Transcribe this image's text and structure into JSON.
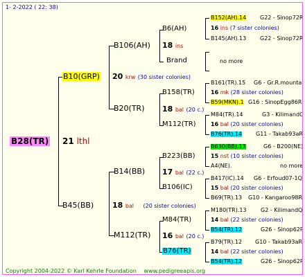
{
  "header": {
    "date": "1-  2-2022 ( 22: 38)"
  },
  "footer": {
    "copyright": "Copyright 2004-2022 © Karl Kehrle Foundation",
    "website": "www.pedigreeapis.org"
  },
  "root": {
    "code": "B28(TR)",
    "num": "21",
    "tag": "lthl"
  },
  "g1_father": {
    "code": "B10(GRP)",
    "num": "20",
    "tag": "krw",
    "sisters": "(30 sister colonies)"
  },
  "g1_mother": {
    "code": "B45(BB)",
    "num": "18",
    "tag": "bal",
    "sisters": "(20 sister colonies)"
  },
  "g2": {
    "b106": {
      "code": "B106(AH)",
      "num": "18",
      "tag": "ins"
    },
    "b20": {
      "code": "B20(TR)"
    },
    "b14": {
      "code": "B14(BB)",
      "num": "17",
      "tag": "bal",
      "sisters": "(22 c.)"
    },
    "m112": {
      "code": "M112(TR)",
      "num": "16",
      "tag": "bal",
      "sisters": "(20 c.)"
    }
  },
  "g3": {
    "b6": {
      "code": "B6(AH)"
    },
    "brand": {
      "code": "Brand"
    },
    "b158": {
      "code": "B158(TR)",
      "num": "18",
      "tag": "bal",
      "sisters": "(20 c.)"
    },
    "m112b": {
      "code": "M112(TR)"
    },
    "b223": {
      "code": "B223(BB)",
      "num": "17",
      "tag": "bal",
      "sisters": "(22 c.)"
    },
    "b106ic": {
      "code": "B106(IC)"
    },
    "m84": {
      "code": "M84(TR)",
      "num": "16",
      "tag": "bal",
      "sisters": "(20 c.)"
    },
    "b76": {
      "code": "B76(TR)"
    }
  },
  "g4": [
    {
      "code": "B152(AH).14",
      "ref": "G22 - Sinop72R"
    },
    {
      "num": "16",
      "tag": "ins",
      "sisters": "(7 sister colonies)"
    },
    {
      "code": "B145(AH).13",
      "ref": "G22 - Sinop72R"
    },
    {
      "text": "no more"
    },
    {
      "code": "B161(TR).15",
      "ref": "G6 - Gr.R.mounta"
    },
    {
      "num": "16",
      "tag": "mk",
      "sisters": "(28 sister colonies)"
    },
    {
      "code": "B59(MKN).1",
      "ref": "G16 : SinopEgg86R"
    },
    {
      "code": "M84(TR).14",
      "ref": "G3 - KilimandQ"
    },
    {
      "num": "16",
      "tag": "bal",
      "sisters": "(20 sister colonies)"
    },
    {
      "code": "B76(TR).14",
      "ref": "G11 - Takab93aR"
    },
    {
      "code": "B630(BB).13",
      "ref": "G6 - B200(NE)"
    },
    {
      "num": "15",
      "tag": "nst",
      "sisters": "(10 sister colonies)"
    },
    {
      "code": "A4(NE).",
      "ref": "no more"
    },
    {
      "code": "B417(IC).14",
      "ref": "G6 - Erfoud07-1Q"
    },
    {
      "num": "15",
      "tag": "bal",
      "sisters": "(20 sister colonies)"
    },
    {
      "code": "B69(TR).13",
      "ref": "G10 - Kangaroo98R"
    },
    {
      "code": "M180(TR).13",
      "ref": "G2 - KilimandQ"
    },
    {
      "num": "14",
      "tag": "bal",
      "sisters": "(22 sister colonies)"
    },
    {
      "code": "B54(TR).12",
      "ref": "G26 - Sinop62R"
    },
    {
      "code": "B79(TR).12",
      "ref": "G10 - Takab93aR"
    },
    {
      "num": "14",
      "tag": "bal",
      "sisters": "(22 sister colonies)"
    },
    {
      "code": "B54(TR).12",
      "ref": "G26 - Sinop62R"
    }
  ],
  "colors": {
    "border": "#ff55ff",
    "background": "#ffffec",
    "highlight_yellow": "#ffff00",
    "highlight_pink": "#ff88ff",
    "highlight_green": "#00ee00",
    "highlight_cyan": "#00eeff",
    "red_text": "#cc0000",
    "blue_text": "#0000cc",
    "footer_text": "#008800"
  }
}
